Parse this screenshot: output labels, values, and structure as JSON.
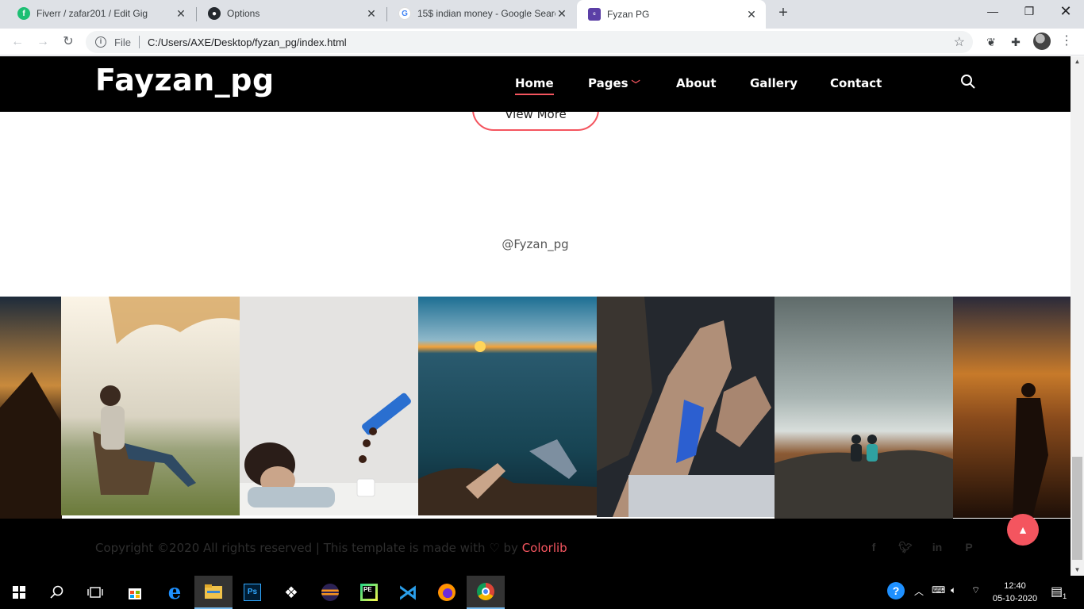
{
  "browser": {
    "tabs": [
      {
        "title": "Fiverr / zafar201 / Edit Gig",
        "favicon": "fiverr-icon",
        "active": false
      },
      {
        "title": "Options",
        "favicon": "github-icon",
        "active": false
      },
      {
        "title": "15$ indian money - Google Searc",
        "favicon": "google-icon",
        "active": false
      },
      {
        "title": "Fyzan PG",
        "favicon": "colorlib-icon",
        "active": true
      }
    ],
    "address": {
      "scheme": "File",
      "url": "C:/Users/AXE/Desktop/fyzan_pg/index.html"
    }
  },
  "site": {
    "logo": "Fayzan_pg",
    "nav": [
      {
        "label": "Home",
        "active": true
      },
      {
        "label": "Pages",
        "dropdown": true
      },
      {
        "label": "About"
      },
      {
        "label": "Gallery"
      },
      {
        "label": "Contact"
      }
    ],
    "view_more": "View More",
    "handle": "@Fyzan_pg",
    "photos": [
      "mountain-sunset-photo",
      "man-on-chair-photo",
      "man-with-biscuits-photo",
      "sea-sunset-photo",
      "hands-creative-photo",
      "couple-above-clouds-photo",
      "hiker-sunset-photo"
    ],
    "footer": {
      "copyright_prefix": "Copyright ©2020 All rights reserved | This template is made with",
      "copyright_by": "by",
      "brand": "Colorlib",
      "social": [
        "facebook-icon",
        "twitter-icon",
        "linkedin-icon",
        "pinterest-icon"
      ]
    },
    "accent": "#f4555f"
  },
  "taskbar": {
    "time": "12:40",
    "date": "05-10-2020",
    "notification_count": "1"
  }
}
